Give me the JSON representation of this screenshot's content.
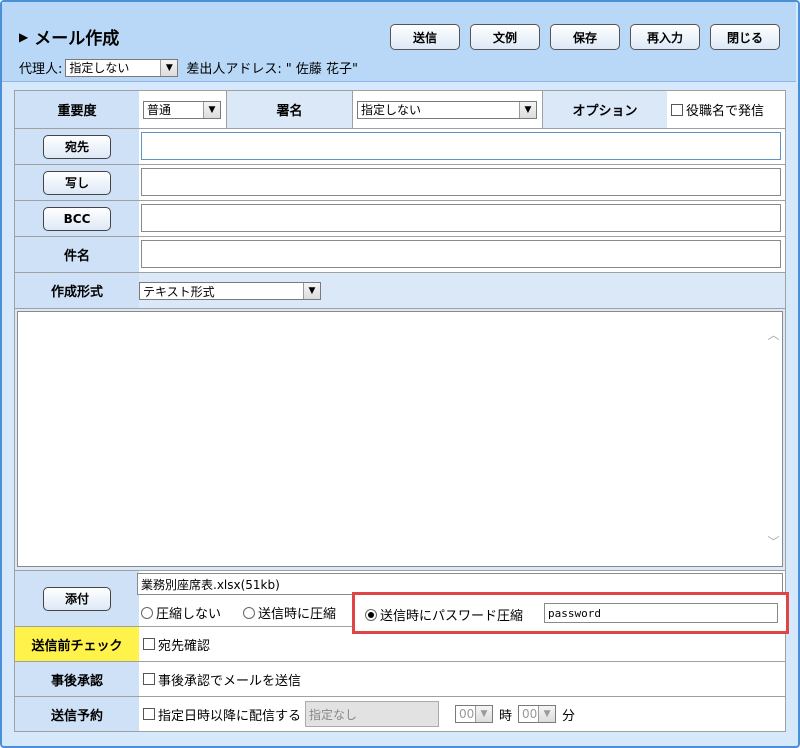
{
  "header": {
    "title": "メール作成",
    "buttons": [
      "送信",
      "文例",
      "保存",
      "再入力",
      "閉じる"
    ],
    "proxy_label": "代理人:",
    "proxy_value": "指定しない",
    "sender_label": "差出人アドレス:",
    "sender_value": "\" 佐藤 花子\""
  },
  "form": {
    "priority_label": "重要度",
    "priority_value": "普通",
    "signature_label": "署名",
    "signature_value": "指定しない",
    "option_label": "オプション",
    "option_check": "役職名で発信",
    "to_button": "宛先",
    "cc_button": "写し",
    "bcc_button": "BCC",
    "subject_label": "件名",
    "format_label": "作成形式",
    "format_value": "テキスト形式",
    "attach_button": "添付",
    "attachment_file": "業務別座席表.xlsx(51kb)",
    "compress_none": "圧縮しない",
    "compress_send": "送信時に圧縮",
    "compress_password": "送信時にパスワード圧縮",
    "password_value": "password",
    "precheck_label": "送信前チェック",
    "precheck_option": "宛先確認",
    "approval_label": "事後承認",
    "approval_option": "事後承認でメールを送信",
    "schedule_label": "送信予約",
    "schedule_option": "指定日時以降に配信する",
    "schedule_date": "指定なし",
    "hour_value": "00",
    "hour_unit": "時",
    "minute_value": "00",
    "minute_unit": "分"
  },
  "colors": {
    "header_bg": "#b9d8f7",
    "label_bg": "#cfe1f7",
    "precheck_bg": "#fff24a",
    "highlight_border": "#e04545"
  }
}
